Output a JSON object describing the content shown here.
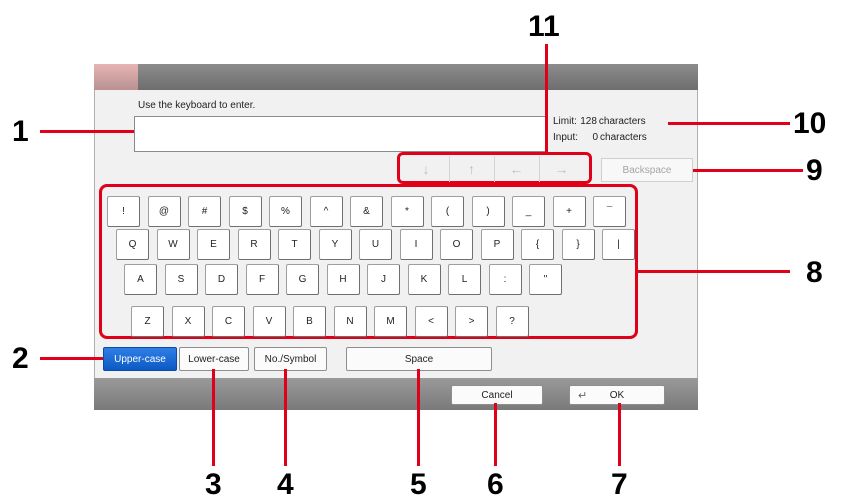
{
  "dialog": {
    "instruction": "Use the keyboard to enter.",
    "input_value": "",
    "limit_label": "Limit:",
    "limit_value": "128",
    "input_label": "Input:",
    "input_count": "0",
    "unit": "characters",
    "backspace_label": "Backspace"
  },
  "keyboard": {
    "rows": [
      [
        "!",
        "@",
        "#",
        "$",
        "%",
        "^",
        "&",
        "*",
        "(",
        ")",
        "_",
        "+",
        "¯"
      ],
      [
        "Q",
        "W",
        "E",
        "R",
        "T",
        "Y",
        "U",
        "I",
        "O",
        "P",
        "{",
        "}",
        "|"
      ],
      [
        "A",
        "S",
        "D",
        "F",
        "G",
        "H",
        "J",
        "K",
        "L",
        ":",
        "\""
      ],
      [
        "Z",
        "X",
        "C",
        "V",
        "B",
        "N",
        "M",
        "<",
        ">",
        "?"
      ]
    ]
  },
  "cursor_keys": [
    {
      "glyph": "↓",
      "icon": "cursor-down-icon"
    },
    {
      "glyph": "↑",
      "icon": "cursor-up-icon"
    },
    {
      "glyph": "←",
      "icon": "cursor-left-icon"
    },
    {
      "glyph": "→",
      "icon": "cursor-right-icon"
    }
  ],
  "mode_buttons": {
    "upper": "Upper-case",
    "lower": "Lower-case",
    "symbol": "No./Symbol",
    "space": "Space",
    "active": "upper"
  },
  "footer": {
    "cancel": "Cancel",
    "ok": "OK",
    "enter_glyph": "↵"
  },
  "callouts": [
    "1",
    "2",
    "3",
    "4",
    "5",
    "6",
    "7",
    "8",
    "9",
    "10",
    "11"
  ],
  "colors": {
    "callout_red": "#e1001a",
    "active_blue": "#0c59c4"
  }
}
